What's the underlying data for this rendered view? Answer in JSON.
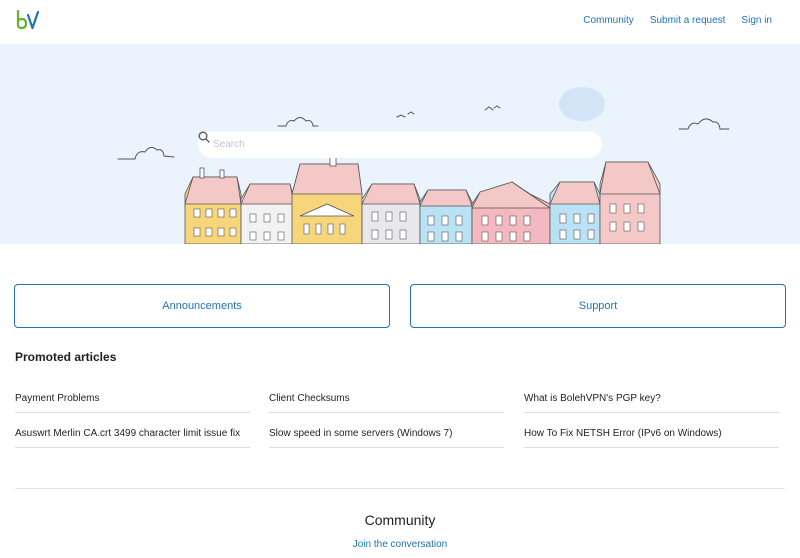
{
  "header": {
    "logo_alt": "bV",
    "nav": [
      {
        "label": "Community"
      },
      {
        "label": "Submit a request"
      },
      {
        "label": "Sign in"
      }
    ]
  },
  "hero": {
    "search_placeholder": "Search"
  },
  "cards": [
    {
      "label": "Announcements"
    },
    {
      "label": "Support"
    }
  ],
  "promoted": {
    "title": "Promoted articles",
    "articles": [
      {
        "label": "Payment Problems"
      },
      {
        "label": "Client Checksums"
      },
      {
        "label": "What is BolehVPN's PGP key?"
      },
      {
        "label": "Asuswrt Merlin CA.crt 3499 character limit issue fix"
      },
      {
        "label": "Slow speed in some servers (Windows 7)"
      },
      {
        "label": "How To Fix NETSH Error (IPv6 on Windows)"
      }
    ]
  },
  "community": {
    "title": "Community",
    "link": "Join the conversation"
  },
  "colors": {
    "accent": "#1f73b7",
    "hero_bg": "#ebf3fd",
    "logo_green": "#6ab22e",
    "logo_blue": "#1f73b7"
  }
}
